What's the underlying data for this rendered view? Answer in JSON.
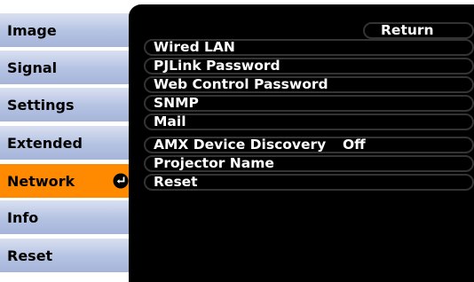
{
  "tabs": [
    {
      "label": "Image"
    },
    {
      "label": "Signal"
    },
    {
      "label": "Settings"
    },
    {
      "label": "Extended"
    },
    {
      "label": "Network",
      "active": true
    },
    {
      "label": "Info"
    },
    {
      "label": "Reset"
    }
  ],
  "panel": {
    "return_label": "Return",
    "items": [
      {
        "label": "Wired LAN"
      },
      {
        "label": "PJLink Password"
      },
      {
        "label": "Web Control Password"
      },
      {
        "label": "SNMP"
      },
      {
        "label": "Mail"
      },
      {
        "label": "AMX Device Discovery",
        "value": "Off"
      },
      {
        "label": "Projector Name"
      },
      {
        "label": "Reset"
      }
    ]
  },
  "colors": {
    "active_tab": "#ff8a00",
    "tab_bg": "#b4c2e2",
    "panel_bg": "#000000",
    "text_on_panel": "#ffffff"
  },
  "icons": {
    "active_tab_icon": "enter-icon"
  }
}
